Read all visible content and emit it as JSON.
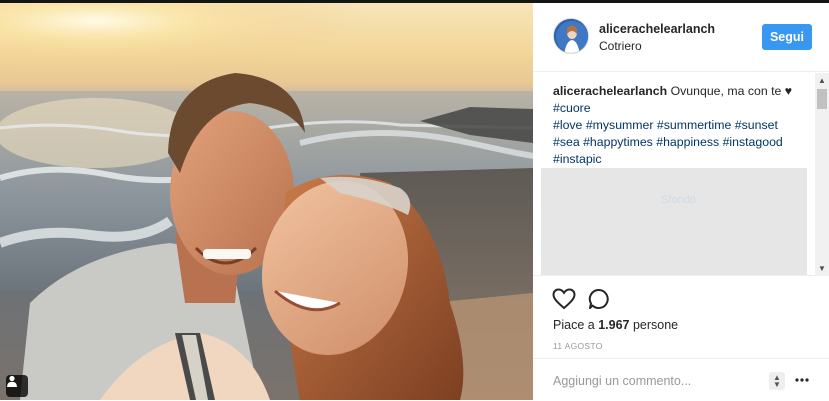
{
  "post": {
    "photo_alt": "",
    "user_tag_icon": "user-tag-icon"
  },
  "header": {
    "username": "alicerachelearlanch",
    "location": "Cotriero",
    "follow_label": "Segui"
  },
  "caption": {
    "username": "alicerachelearlanch",
    "text": "Ovunque, ma con te",
    "heart": "♥",
    "hashtags_line1": [
      "#cuore"
    ],
    "hashtags_line2": [
      "#love",
      "#mysummer",
      "#summertime",
      "#sunset"
    ],
    "hashtags_line3": [
      "#sea",
      "#happytimes",
      "#happiness",
      "#instagood"
    ],
    "hashtags_line4": [
      "#instapic"
    ]
  },
  "embed": {
    "text": "Sfondo"
  },
  "actions": {
    "likes_prefix": "Piace a",
    "likes_count": "1.967",
    "likes_suffix": "persone",
    "date": "11 AGOSTO",
    "comment_placeholder": "Aggiungi un commento...",
    "more": "•••"
  },
  "icons": {
    "like": "heart-outline-icon",
    "comment": "comment-bubble-icon",
    "more": "more-dots-icon"
  }
}
